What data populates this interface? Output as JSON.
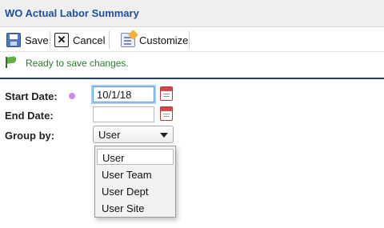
{
  "title": "WO Actual Labor Summary",
  "toolbar": {
    "save_label": "Save",
    "cancel_label": "Cancel",
    "customize_label": "Customize"
  },
  "status": "Ready to save changes.",
  "form": {
    "start_date_label": "Start Date:",
    "start_date_value": "10/1/18",
    "end_date_label": "End Date:",
    "end_date_value": "",
    "group_by_label": "Group by:",
    "group_by_value": "User",
    "group_by_options": [
      "User",
      "User Team",
      "User Dept",
      "User Site"
    ]
  },
  "colors": {
    "title": "#1f4fa3",
    "status": "#2b7d2b",
    "divider": "#1f3d7a",
    "required_dot": "#c78ce6"
  }
}
